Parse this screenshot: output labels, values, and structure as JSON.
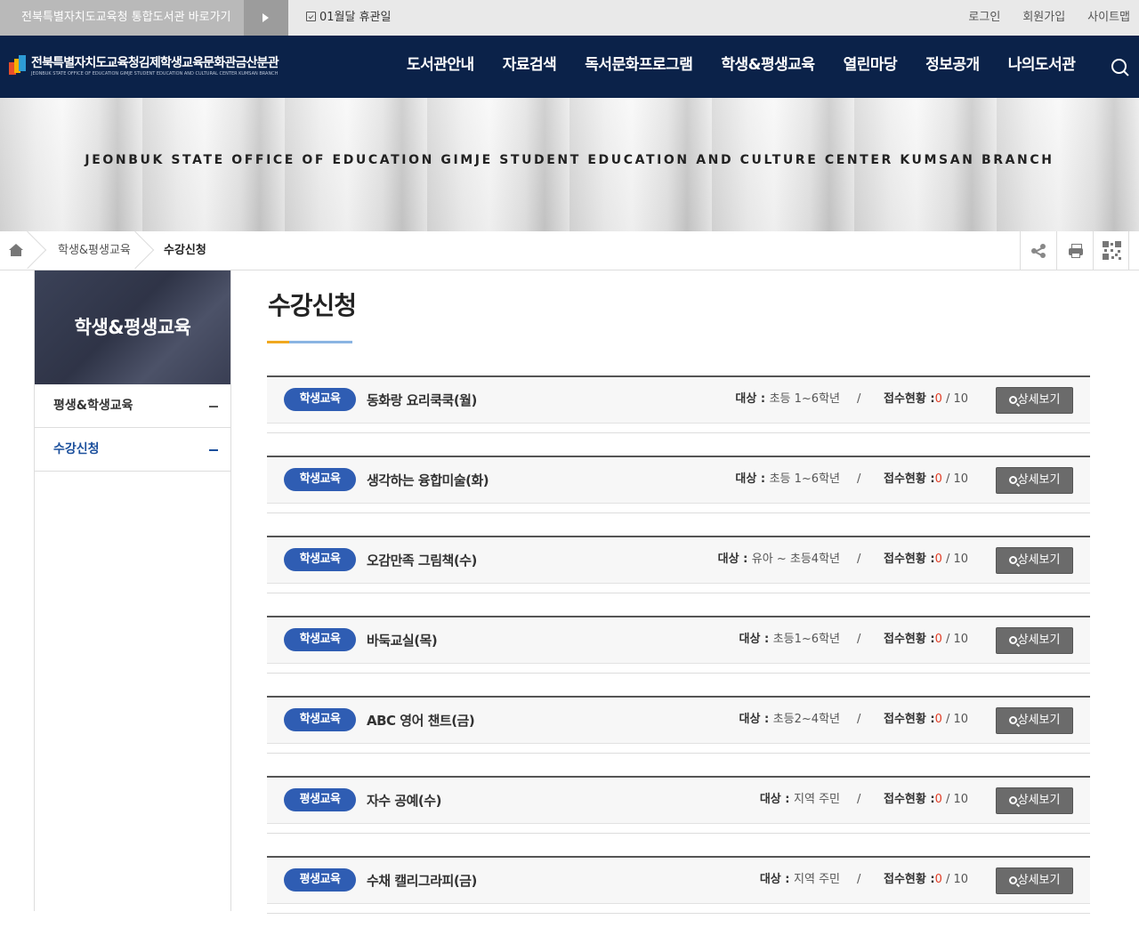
{
  "topbar": {
    "integrated_link": "전북특별자치도교육청 통합도서관 바로가기",
    "closed_days": "01월달 휴관일",
    "login": "로그인",
    "signup": "회원가입",
    "sitemap": "사이트맵"
  },
  "header": {
    "logo_ko": "전북특별자치도교육청김제학생교육문화관금산분관",
    "logo_en": "JEONBUK STATE OFFICE OF EDUCATION GIMJE STUDENT EDUCATION AND CULTURAL CENTER KUMSAN BRANCH",
    "nav": [
      "도서관안내",
      "자료검색",
      "독서문화프로그램",
      "학생&평생교육",
      "열린마당",
      "정보공개",
      "나의도서관"
    ]
  },
  "banner": {
    "text": "JEONBUK STATE OFFICE OF EDUCATION GIMJE STUDENT EDUCATION AND CULTURE CENTER KUMSAN BRANCH"
  },
  "breadcrumb": [
    "학생&평생교육",
    "수강신청"
  ],
  "side": {
    "title": "학생&평생교육",
    "items": [
      "평생&학생교육",
      "수강신청"
    ]
  },
  "page": {
    "title": "수강신청"
  },
  "labels": {
    "target": "대상 : ",
    "status": "접수현황 :",
    "detail": "상세보기"
  },
  "courses": [
    {
      "category": "학생교육",
      "name": "동화랑 요리쿡쿡(월)",
      "target": "초등 1~6학년",
      "applied": "0",
      "capacity": " / 10"
    },
    {
      "category": "학생교육",
      "name": "생각하는 융합미술(화)",
      "target": "초등 1~6학년",
      "applied": "0",
      "capacity": " / 10"
    },
    {
      "category": "학생교육",
      "name": "오감만족 그림책(수)",
      "target": "유아 ~ 초등4학년",
      "applied": "0",
      "capacity": " / 10"
    },
    {
      "category": "학생교육",
      "name": "바둑교실(목)",
      "target": "초등1~6학년",
      "applied": "0",
      "capacity": " / 10"
    },
    {
      "category": "학생교육",
      "name": "ABC 영어 챈트(금)",
      "target": "초등2~4학년",
      "applied": "0",
      "capacity": " / 10"
    },
    {
      "category": "평생교육",
      "name": "자수 공예(수)",
      "target": "지역 주민",
      "applied": "0",
      "capacity": " / 10"
    },
    {
      "category": "평생교육",
      "name": "수채 캘리그라피(금)",
      "target": "지역 주민",
      "applied": "0",
      "capacity": " / 10"
    }
  ]
}
